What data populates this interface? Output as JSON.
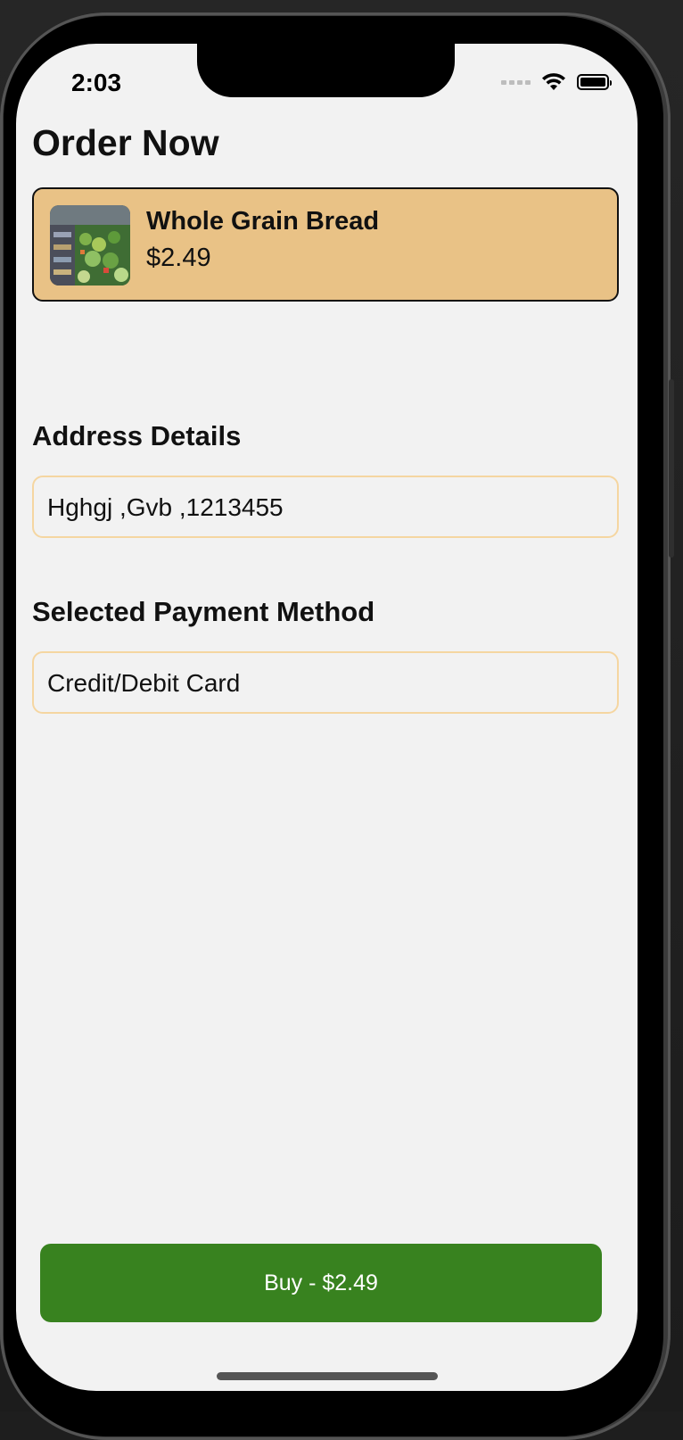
{
  "status_bar": {
    "time": "2:03"
  },
  "page": {
    "title": "Order Now"
  },
  "product": {
    "name": "Whole Grain Bread",
    "price": "$2.49",
    "card_color": "#e9c286"
  },
  "address": {
    "label": "Address Details",
    "value": "Hghgj ,Gvb ,1213455"
  },
  "payment": {
    "label": "Selected Payment Method",
    "value": "Credit/Debit Card"
  },
  "buy_button": {
    "label": "Buy - $2.49",
    "color": "#38821f"
  },
  "icons": {
    "signal": "cellular-signal-icon",
    "wifi": "wifi-icon",
    "battery": "battery-icon"
  }
}
